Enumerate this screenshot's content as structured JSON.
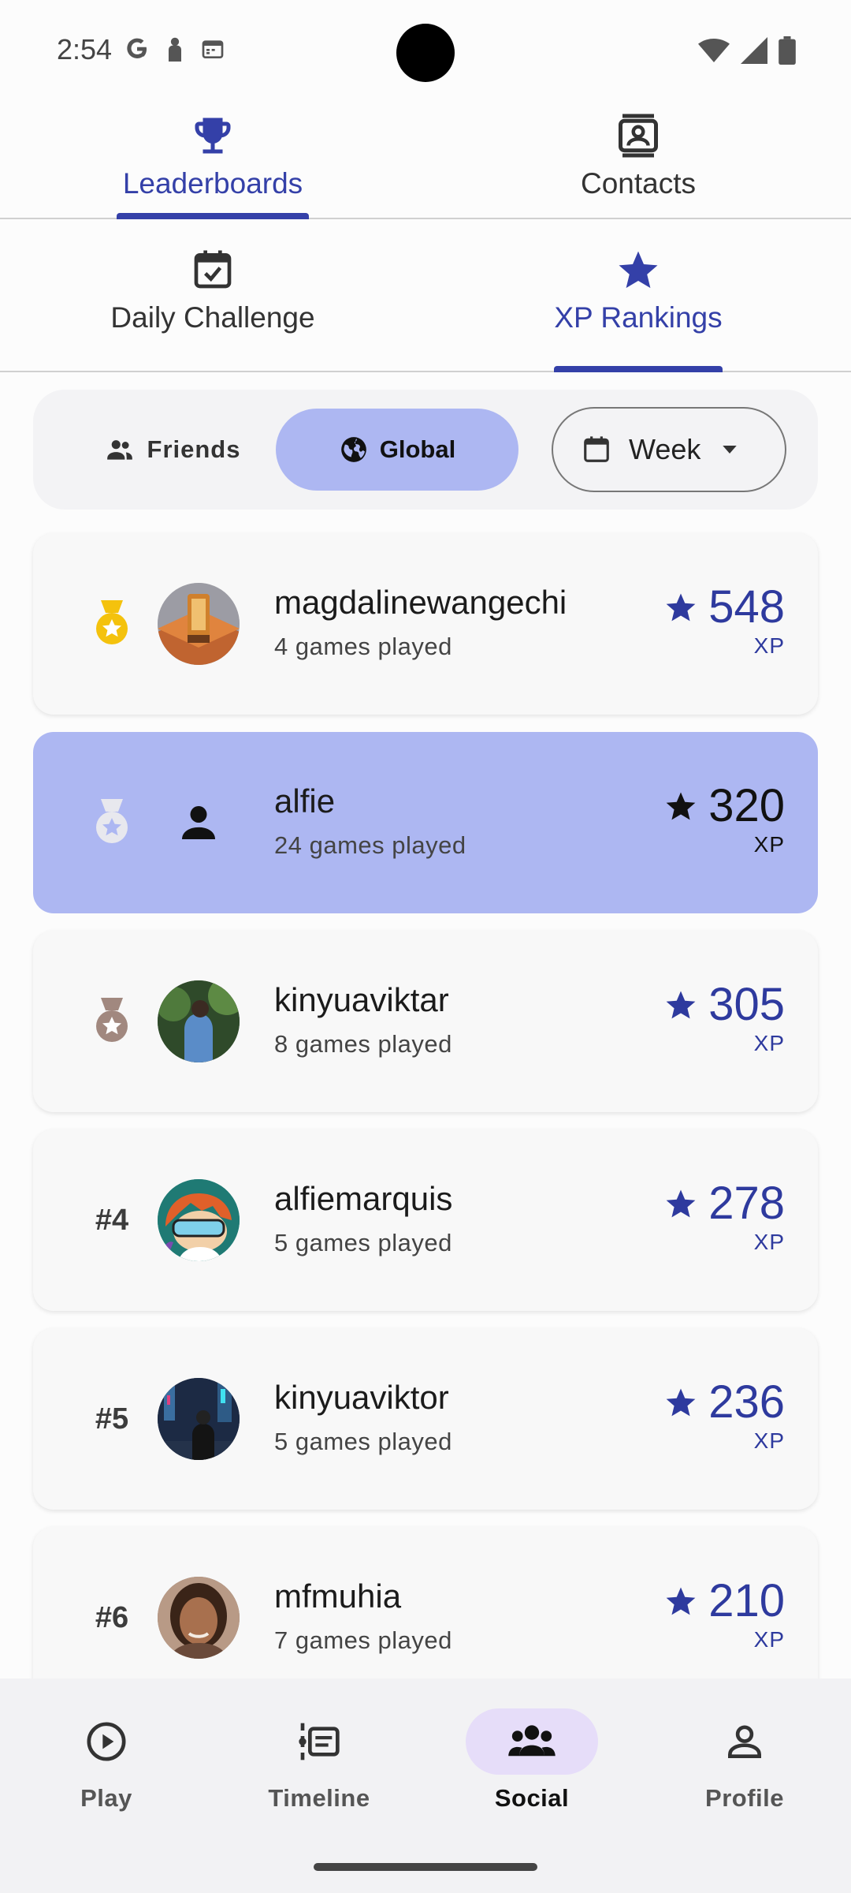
{
  "status_bar": {
    "time": "2:54"
  },
  "top_tabs": [
    {
      "label": "Leaderboards",
      "icon": "trophy-icon",
      "active": true
    },
    {
      "label": "Contacts",
      "icon": "contacts-icon",
      "active": false
    }
  ],
  "sub_tabs": [
    {
      "label": "Daily Challenge",
      "icon": "calendar-check-icon",
      "active": false
    },
    {
      "label": "XP Rankings",
      "icon": "star-icon",
      "active": true
    }
  ],
  "filter": {
    "friends_label": "Friends",
    "global_label": "Global",
    "selected_scope": "Global",
    "period_value": "Week"
  },
  "leaderboard": {
    "unit": "XP",
    "rows": [
      {
        "rank": "#1",
        "name": "magdalinewangechi",
        "sub": "4 games played",
        "xp": "548",
        "medal": "gold",
        "avatar": "phone-booth-avatar"
      },
      {
        "rank": "#2",
        "name": "alfie",
        "sub": "24 games played",
        "xp": "320",
        "medal": "silver",
        "avatar": "default-person-avatar",
        "current_user": true
      },
      {
        "rank": "#3",
        "name": "kinyuaviktar",
        "sub": "8 games played",
        "xp": "305",
        "medal": "bronze",
        "avatar": "photo-avatar"
      },
      {
        "rank": "#4",
        "name": "alfiemarquis",
        "sub": "5 games played",
        "xp": "278",
        "avatar": "cartoon-avatar"
      },
      {
        "rank": "#5",
        "name": "kinyuaviktor",
        "sub": "5 games played",
        "xp": "236",
        "avatar": "photo-avatar"
      },
      {
        "rank": "#6",
        "name": "mfmuhia",
        "sub": "7 games played",
        "xp": "210",
        "avatar": "photo-avatar"
      }
    ]
  },
  "bottom_nav": [
    {
      "label": "Play",
      "icon": "play-circle-icon",
      "active": false
    },
    {
      "label": "Timeline",
      "icon": "timeline-icon",
      "active": false
    },
    {
      "label": "Social",
      "icon": "group-icon",
      "active": true
    },
    {
      "label": "Profile",
      "icon": "person-icon",
      "active": false
    }
  ],
  "colors": {
    "accent": "#3440a8",
    "selected_row": "#adb7f2",
    "gold": "#f4c20d",
    "silver": "#e8e8ee",
    "bronze": "#a1887f",
    "active_nav_pill": "#e6ddf9"
  }
}
